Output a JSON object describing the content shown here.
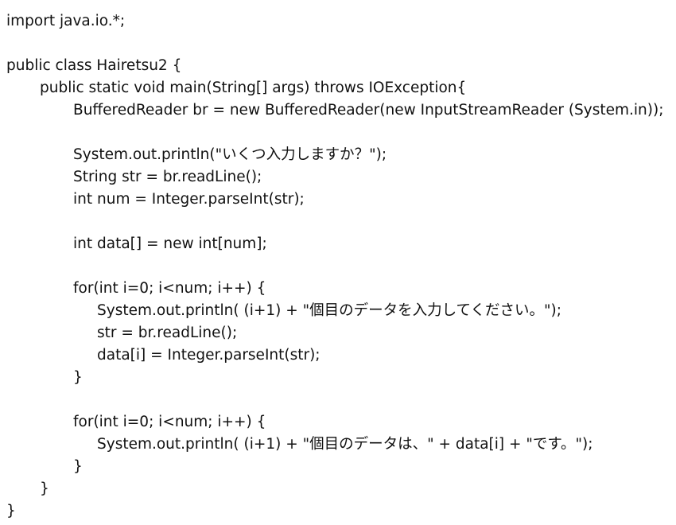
{
  "code": {
    "lines": [
      {
        "text": "import java.io.*;"
      },
      {
        "text": ""
      },
      {
        "text": "public class Hairetsu2 {"
      },
      {
        "text": "public static void main(String[] args) throws IOException{"
      },
      {
        "text": "BufferedReader br = new BufferedReader(new InputStreamReader (System.in));"
      },
      {
        "text": ""
      },
      {
        "text": "System.out.println(\"いくつ入力しますか？\");"
      },
      {
        "text": "String str = br.readLine();"
      },
      {
        "text": "int num = Integer.parseInt(str);"
      },
      {
        "text": ""
      },
      {
        "text": "int data[] = new int[num];"
      },
      {
        "text": ""
      },
      {
        "text": "for(int i=0; i<num; i++) {"
      },
      {
        "text": "System.out.println( (i+1) + \"個目のデータを入力してください。\");"
      },
      {
        "text": "str = br.readLine();"
      },
      {
        "text": "data[i] = Integer.parseInt(str);"
      },
      {
        "text": "}"
      },
      {
        "text": ""
      },
      {
        "text": "for(int i=0; i<num; i++) {"
      },
      {
        "text": "System.out.println( (i+1) + \"個目のデータは、\" + data[i] + \"です。\");"
      },
      {
        "text": "}"
      },
      {
        "text": "}"
      },
      {
        "text": "}"
      }
    ]
  }
}
